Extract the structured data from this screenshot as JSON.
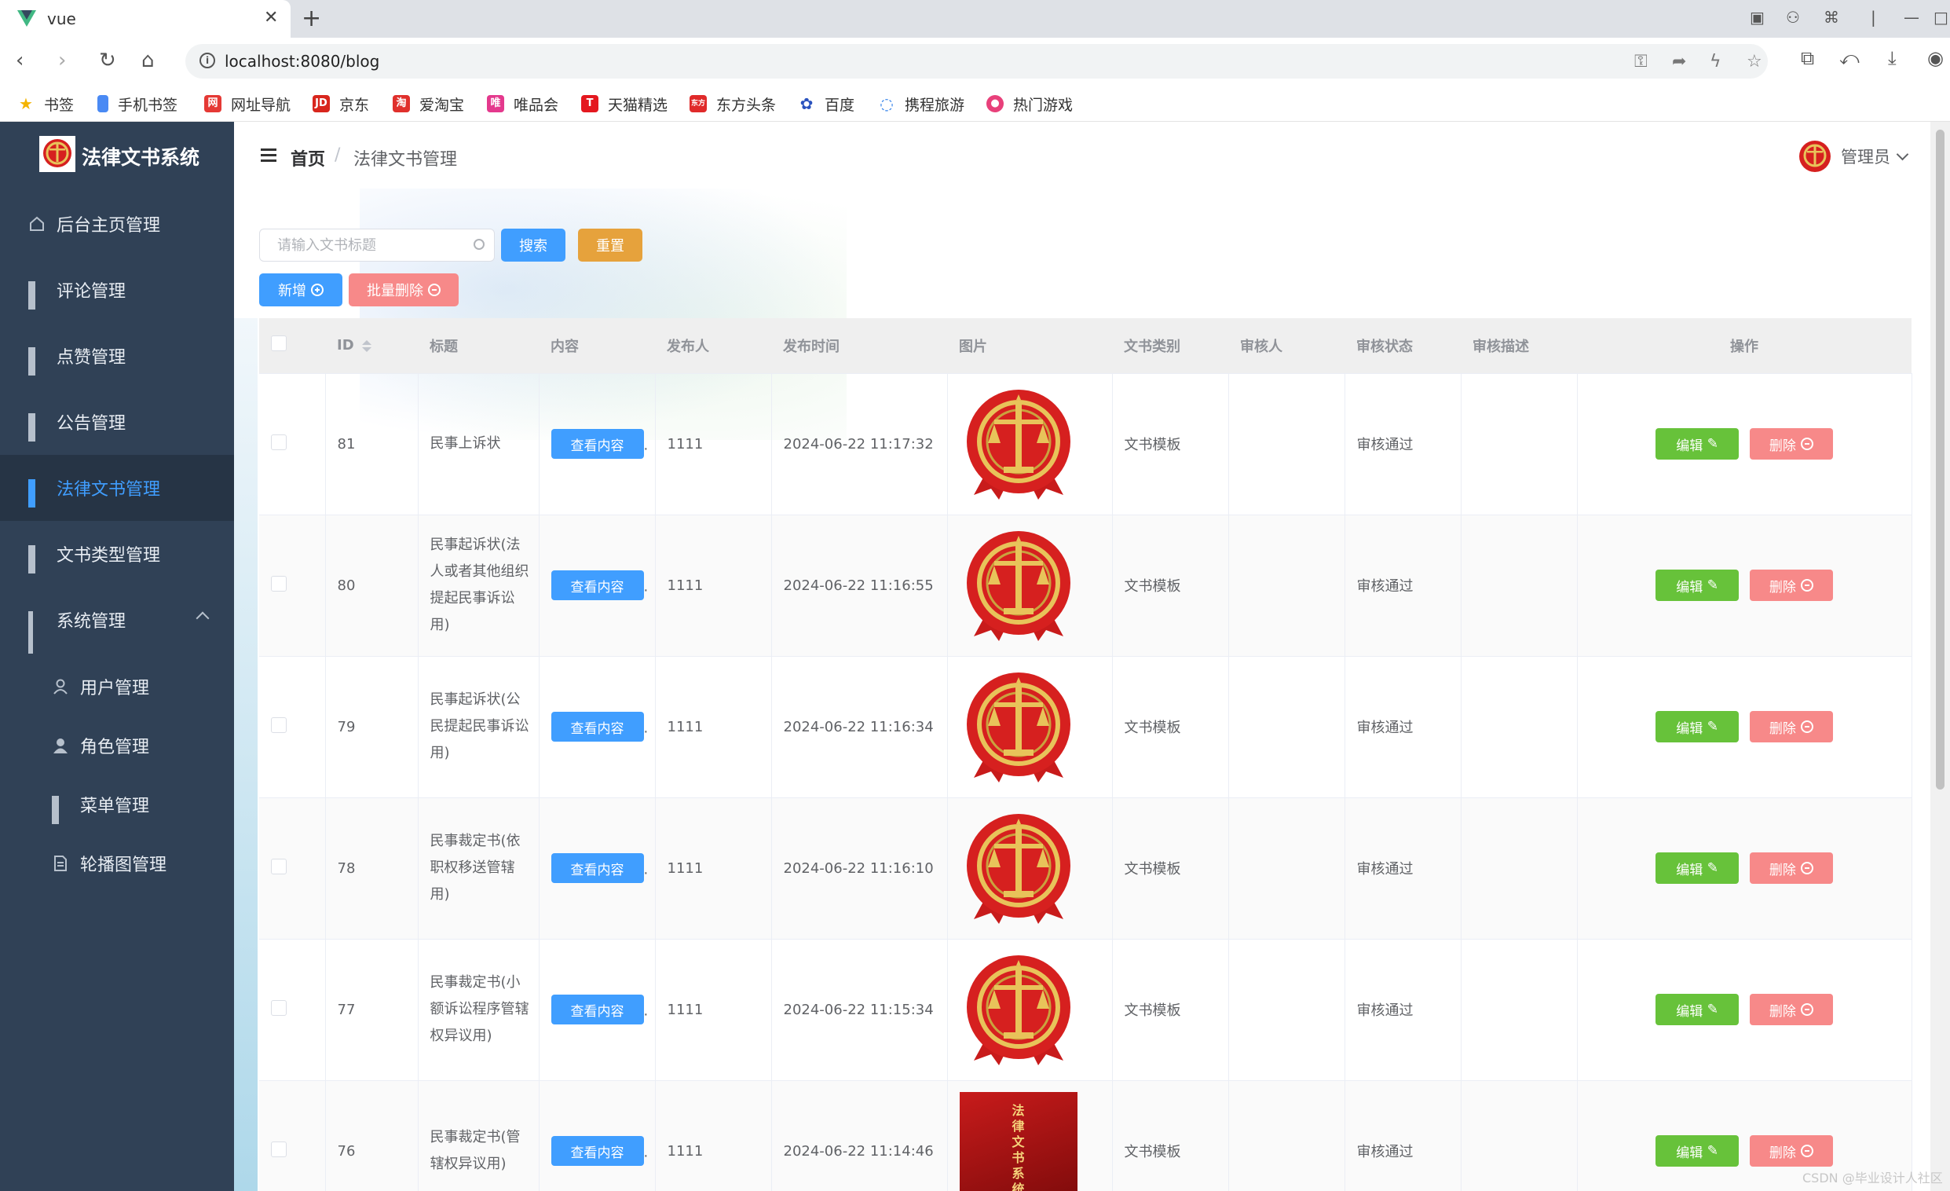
{
  "browser": {
    "tab_title": "vue",
    "url": "localhost:8080/blog",
    "bookmarks": [
      "书签",
      "手机书签",
      "网址导航",
      "京东",
      "爱淘宝",
      "唯品会",
      "天猫精选",
      "东方头条",
      "百度",
      "携程旅游",
      "热门游戏"
    ]
  },
  "sidebar": {
    "brand": "法律文书系统",
    "items": [
      "后台主页管理",
      "评论管理",
      "点赞管理",
      "公告管理",
      "法律文书管理",
      "文书类型管理",
      "系统管理"
    ],
    "subitems": [
      "用户管理",
      "角色管理",
      "菜单管理",
      "轮播图管理"
    ],
    "active": "法律文书管理"
  },
  "header": {
    "breadcrumb_home": "首页",
    "breadcrumb_sep": "/",
    "breadcrumb_current": "法律文书管理",
    "user": "管理员"
  },
  "toolbar": {
    "search_placeholder": "请输入文书标题",
    "search_label": "搜索",
    "reset_label": "重置",
    "add_label": "新增",
    "batch_delete_label": "批量删除"
  },
  "table": {
    "columns": [
      "ID",
      "标题",
      "内容",
      "发布人",
      "发布时间",
      "图片",
      "文书类别",
      "审核人",
      "审核状态",
      "审核描述",
      "操作"
    ],
    "view_label": "查看内容",
    "edit_label": "编辑",
    "delete_label": "删除",
    "rows": [
      {
        "id": "81",
        "title": "民事上诉状",
        "publisher": "1111",
        "time": "2024-06-22 11:17:32",
        "image": "emblem",
        "category": "文书模板",
        "reviewer": "",
        "status": "审核通过",
        "desc": ""
      },
      {
        "id": "80",
        "title": "民事起诉状(法人或者其他组织提起民事诉讼用)",
        "publisher": "1111",
        "time": "2024-06-22 11:16:55",
        "image": "emblem",
        "category": "文书模板",
        "reviewer": "",
        "status": "审核通过",
        "desc": ""
      },
      {
        "id": "79",
        "title": "民事起诉状(公民提起民事诉讼用)",
        "publisher": "1111",
        "time": "2024-06-22 11:16:34",
        "image": "emblem",
        "category": "文书模板",
        "reviewer": "",
        "status": "审核通过",
        "desc": ""
      },
      {
        "id": "78",
        "title": "民事裁定书(依职权移送管辖用)",
        "publisher": "1111",
        "time": "2024-06-22 11:16:10",
        "image": "emblem",
        "category": "文书模板",
        "reviewer": "",
        "status": "审核通过",
        "desc": ""
      },
      {
        "id": "77",
        "title": "民事裁定书(小额诉讼程序管辖权异议用)",
        "publisher": "1111",
        "time": "2024-06-22 11:15:34",
        "image": "emblem",
        "category": "文书模板",
        "reviewer": "",
        "status": "审核通过",
        "desc": ""
      },
      {
        "id": "76",
        "title": "民事裁定书(管辖权异议用)",
        "publisher": "1111",
        "time": "2024-06-22 11:14:46",
        "image": "book",
        "category": "文书模板",
        "reviewer": "",
        "status": "审核通过",
        "desc": ""
      }
    ],
    "book_cover_text": "法律文书系统"
  },
  "translate_label": "译",
  "watermark": "CSDN @毕业设计人社区",
  "colors": {
    "sidebar_bg": "#304156",
    "primary": "#409eff",
    "success": "#67c23a",
    "danger": "#f78989",
    "warning": "#e6a23c"
  }
}
